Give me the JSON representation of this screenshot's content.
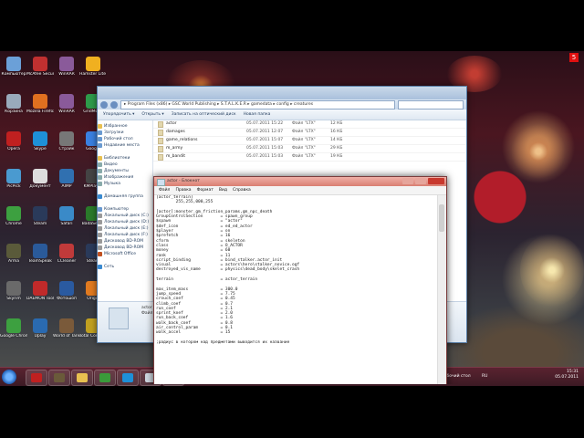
{
  "desktop_icons": [
    {
      "label": "Компьютер",
      "color": "#6ba0d8"
    },
    {
      "label": "McAfee Security Sc...",
      "color": "#c03030"
    },
    {
      "label": "WinRAR",
      "color": "#8a5a9a"
    },
    {
      "label": "Hamster Lite Archiver",
      "color": "#f0b020"
    },
    {
      "label": "Корзина",
      "color": "#9ab"
    },
    {
      "label": "Mozilla Firefox",
      "color": "#e07020"
    },
    {
      "label": "WinRAR",
      "color": "#8a5a9a"
    },
    {
      "label": "GridMove",
      "color": "#2e9a4a"
    },
    {
      "label": "Opera",
      "color": "#c02020"
    },
    {
      "label": "Skype",
      "color": "#1e90d8"
    },
    {
      "label": "Страйк",
      "color": "#777"
    },
    {
      "label": "Google",
      "color": "#3a80e0"
    },
    {
      "label": "PicPick",
      "color": "#4a9ad0"
    },
    {
      "label": "Документ",
      "color": "#ddd"
    },
    {
      "label": "AIMP",
      "color": "#3070b0"
    },
    {
      "label": "KMPlayer",
      "color": "#444"
    },
    {
      "label": "Chrome",
      "color": "#3da040"
    },
    {
      "label": "Steam",
      "color": "#2a3a5a"
    },
    {
      "label": "Safari",
      "color": "#3a8ac8"
    },
    {
      "label": "BadaSetup",
      "color": "#2a7a2a"
    },
    {
      "label": "Arma",
      "color": "#5a5a3a"
    },
    {
      "label": "TeamSpeak",
      "color": "#2a5a9a"
    },
    {
      "label": "CCleaner",
      "color": "#c03a3a"
    },
    {
      "label": "Steam",
      "color": "#2a3a5a"
    },
    {
      "label": "Skyrim",
      "color": "#6a6a6a"
    },
    {
      "label": "DAEMON Tools Lite",
      "color": "#c02a2a"
    },
    {
      "label": "Фотошоп",
      "color": "#2a5aa0"
    },
    {
      "label": "Origin",
      "color": "#e07a20"
    },
    {
      "label": "Google Chrome",
      "color": "#3da040"
    },
    {
      "label": "Uplay",
      "color": "#2a6ab0"
    },
    {
      "label": "World of Tanks",
      "color": "#7a5a3a"
    },
    {
      "label": "Total Commander",
      "color": "#c0a020"
    }
  ],
  "explorer": {
    "path": "▸ Program Files (x86) ▸ GSC World Publishing ▸ S.T.A.L.K.E.R ▸ gamedata ▸ config ▸ creatures",
    "toolbar": [
      "Упорядочить ▾",
      "Открыть ▾",
      "Записать на оптический диск",
      "Новая папка"
    ],
    "nav": [
      {
        "label": "Избранное",
        "color": "#e8c050"
      },
      {
        "label": "Загрузки",
        "color": "#6a9ad0"
      },
      {
        "label": "Рабочий стол",
        "color": "#6a9ad0"
      },
      {
        "label": "Недавние места",
        "color": "#6a9ad0"
      },
      {
        "label": "",
        "color": "transparent"
      },
      {
        "label": "Библиотеки",
        "color": "#e8c050"
      },
      {
        "label": "Видео",
        "color": "#8aa"
      },
      {
        "label": "Документы",
        "color": "#8aa"
      },
      {
        "label": "Изображения",
        "color": "#8aa"
      },
      {
        "label": "Музыка",
        "color": "#8aa"
      },
      {
        "label": "",
        "color": "transparent"
      },
      {
        "label": "Домашняя группа",
        "color": "#3a8ad0"
      },
      {
        "label": "",
        "color": "transparent"
      },
      {
        "label": "Компьютер",
        "color": "#6a9ad0"
      },
      {
        "label": "Локальный диск (C:)",
        "color": "#999"
      },
      {
        "label": "Локальный диск (D:)",
        "color": "#999"
      },
      {
        "label": "Локальный диск (E:)",
        "color": "#999"
      },
      {
        "label": "Локальный диск (F:)",
        "color": "#999"
      },
      {
        "label": "Дисковод BD-ROM",
        "color": "#999"
      },
      {
        "label": "Дисковод BD-ROM",
        "color": "#999"
      },
      {
        "label": "Microsoft Office",
        "color": "#c05020"
      },
      {
        "label": "",
        "color": "transparent"
      },
      {
        "label": "Сеть",
        "color": "#3a8ad0"
      }
    ],
    "files": [
      {
        "name": "actor",
        "date": "05.07.2011 15:22",
        "type": "Файл \"LTX\"",
        "size": "12 КБ"
      },
      {
        "name": "damages",
        "date": "05.07.2011 12:07",
        "type": "Файл \"LTX\"",
        "size": "16 КБ"
      },
      {
        "name": "game_relations",
        "date": "05.07.2011 15:07",
        "type": "Файл \"LTX\"",
        "size": "14 КБ"
      },
      {
        "name": "m_army",
        "date": "05.07.2011 15:03",
        "type": "Файл \"LTX\"",
        "size": "29 КБ"
      },
      {
        "name": "m_bandit",
        "date": "05.07.2011 15:03",
        "type": "Файл \"LTX\"",
        "size": "19 КБ"
      }
    ],
    "status_name": "actor",
    "status_type": "Файл \"LTX\""
  },
  "notepad": {
    "title": "actor - Блокнот",
    "menu": [
      "Файл",
      "Правка",
      "Формат",
      "Вид",
      "Справка"
    ],
    "text": "[actor_terrain]\n        255,255,000,255\n\n[actor]:monster_gm_friction_params,gm_npc_death\nGroupControlSection       = spawn_group\n$spawn                    = \"actor\"\n$def_icon                 = ed_ed_actor\n$player                   = on\n$prefetch                 = 16\ncform                     = skeleton\nclass                     = O_ACTOR\nmoney                     = 60\nrank                      = 11\nscript_binding            = bind_stalker.actor_init\nvisual                    = actors\\hero\\stalker_novice.ogf\ndestroyed_vis_name        = physics\\dead_body\\skelet_crash\n\nterrain                   = actor_terrain\n\nmax_item_mass             = 300.0\njump_speed                = 7.75\ncrouch_coef               = 0.45\nclimb_coef                = 0.7\nrun_coef                  = 2.1\nsprint_koef               = 2.0\nrun_back_coef             = 1.6\nwalk_back_coef            = 0.8\nair_control_param         = 0.1\nwalk_accel                = 15\n\n;радиус в котором над предметами выводится их название"
  },
  "taskbar": {
    "lang_label": "Рабочий стол",
    "lang": "RU",
    "time": "15:31",
    "date": "05.07.2011",
    "buttons": [
      {
        "name": "taskbar-opera",
        "color": "#c02020"
      },
      {
        "name": "taskbar-wot",
        "color": "#6a5a3a"
      },
      {
        "name": "taskbar-explorer",
        "color": "#e8c050"
      },
      {
        "name": "taskbar-utorrent",
        "color": "#3a9a3a"
      },
      {
        "name": "taskbar-skype",
        "color": "#1e90d8"
      },
      {
        "name": "taskbar-notepad-1",
        "color": "#cfd8e0"
      },
      {
        "name": "taskbar-notepad-2",
        "color": "#dfe5ec"
      }
    ]
  },
  "corner_badge": "5"
}
